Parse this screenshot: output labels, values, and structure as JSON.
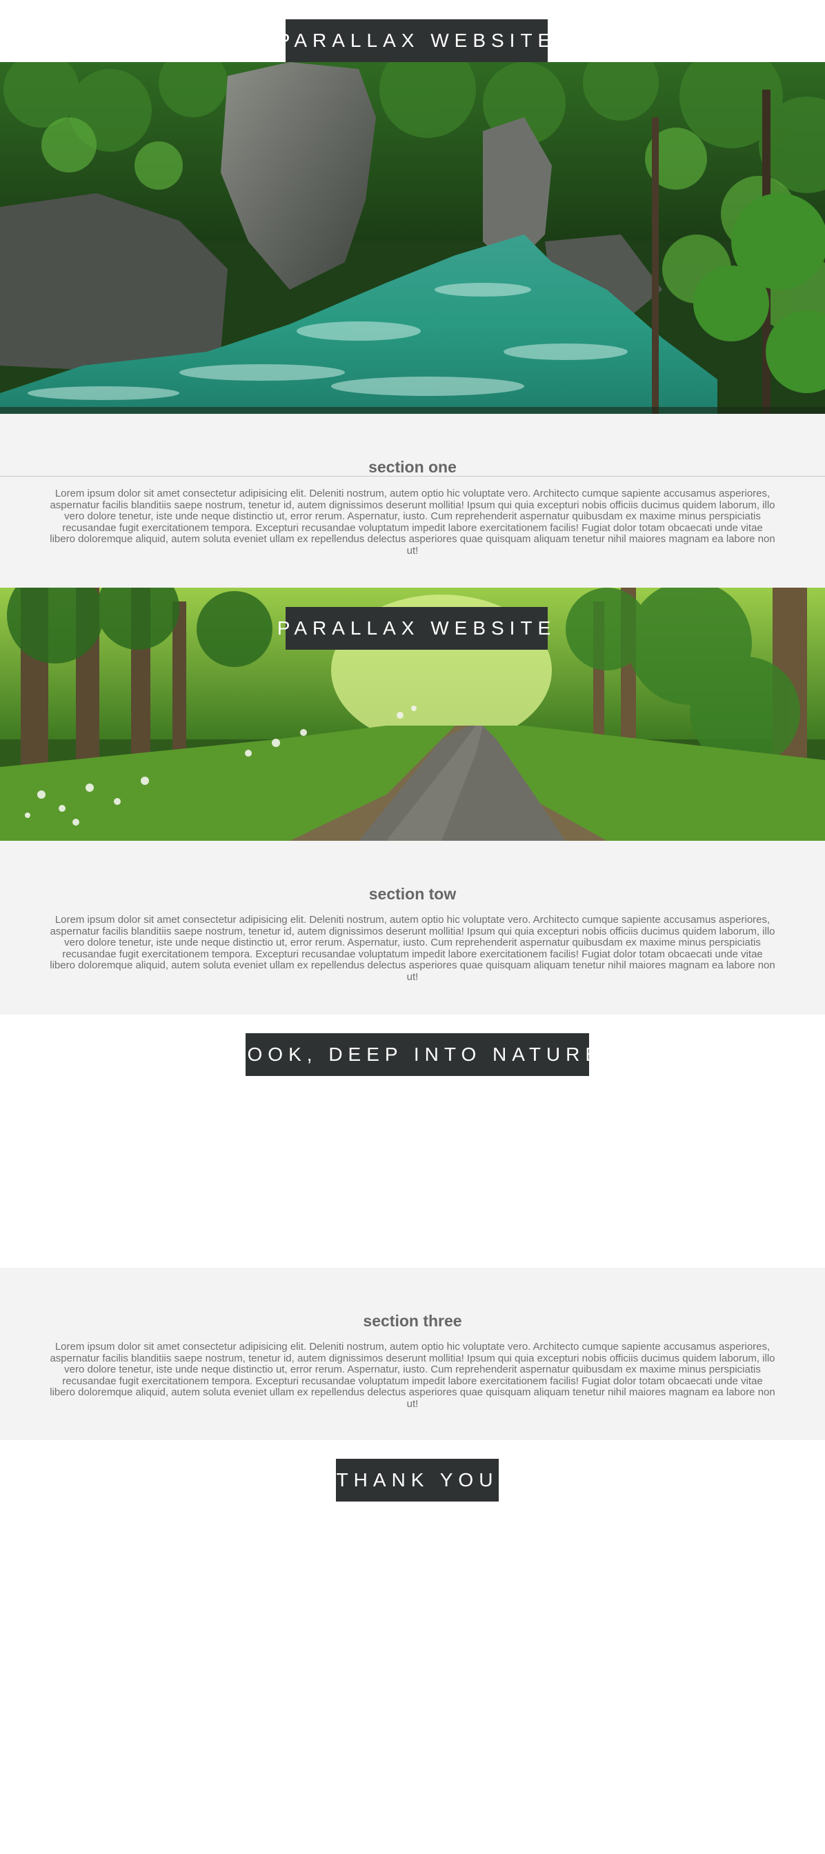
{
  "titles": {
    "hero1": "PARALLAX WEBSITE",
    "hero2": "PARALLAX WEBSITE",
    "hero3": "LOOK, DEEP INTO NATURE",
    "hero4": "THANK YOU"
  },
  "sections": [
    {
      "heading": "section one",
      "body": "Lorem ipsum dolor sit amet consectetur adipisicing elit. Deleniti nostrum, autem optio hic voluptate vero. Architecto cumque sapiente accusamus asperiores, aspernatur facilis blanditiis saepe nostrum, tenetur id, autem dignissimos deserunt mollitia! Ipsum qui quia excepturi nobis officiis ducimus quidem laborum, illo vero dolore tenetur, iste unde neque distinctio ut, error rerum. Aspernatur, iusto. Cum reprehenderit aspernatur quibusdam ex maxime minus perspiciatis recusandae fugit exercitationem tempora. Excepturi recusandae voluptatum impedit labore exercitationem facilis! Fugiat dolor totam obcaecati unde vitae libero doloremque aliquid, autem soluta eveniet ullam ex repellendus delectus asperiores quae quisquam aliquam tenetur nihil maiores magnam ea labore non ut!"
    },
    {
      "heading": "section tow",
      "body": "Lorem ipsum dolor sit amet consectetur adipisicing elit. Deleniti nostrum, autem optio hic voluptate vero. Architecto cumque sapiente accusamus asperiores, aspernatur facilis blanditiis saepe nostrum, tenetur id, autem dignissimos deserunt mollitia! Ipsum qui quia excepturi nobis officiis ducimus quidem laborum, illo vero dolore tenetur, iste unde neque distinctio ut, error rerum. Aspernatur, iusto. Cum reprehenderit aspernatur quibusdam ex maxime minus perspiciatis recusandae fugit exercitationem tempora. Excepturi recusandae voluptatum impedit labore exercitationem facilis! Fugiat dolor totam obcaecati unde vitae libero doloremque aliquid, autem soluta eveniet ullam ex repellendus delectus asperiores quae quisquam aliquam tenetur nihil maiores magnam ea labore non ut!"
    },
    {
      "heading": "section three",
      "body": "Lorem ipsum dolor sit amet consectetur adipisicing elit. Deleniti nostrum, autem optio hic voluptate vero. Architecto cumque sapiente accusamus asperiores, aspernatur facilis blanditiis saepe nostrum, tenetur id, autem dignissimos deserunt mollitia! Ipsum qui quia excepturi nobis officiis ducimus quidem laborum, illo vero dolore tenetur, iste unde neque distinctio ut, error rerum. Aspernatur, iusto. Cum reprehenderit aspernatur quibusdam ex maxime minus perspiciatis recusandae fugit exercitationem tempora. Excepturi recusandae voluptatum impedit labore exercitationem facilis! Fugiat dolor totam obcaecati unde vitae libero doloremque aliquid, autem soluta eveniet ullam ex repellendus delectus asperiores quae quisquam aliquam tenetur nihil maiores magnam ea labore non ut!"
    }
  ],
  "images": {
    "hero1": "river-canyon-forest-image",
    "hero2": "forest-road-image"
  },
  "colors": {
    "title_box": "#2f3232",
    "title_text": "#ffffff",
    "section_bg": "#f3f3f3",
    "section_text": "#666666",
    "page_bg": "#ffffff"
  }
}
